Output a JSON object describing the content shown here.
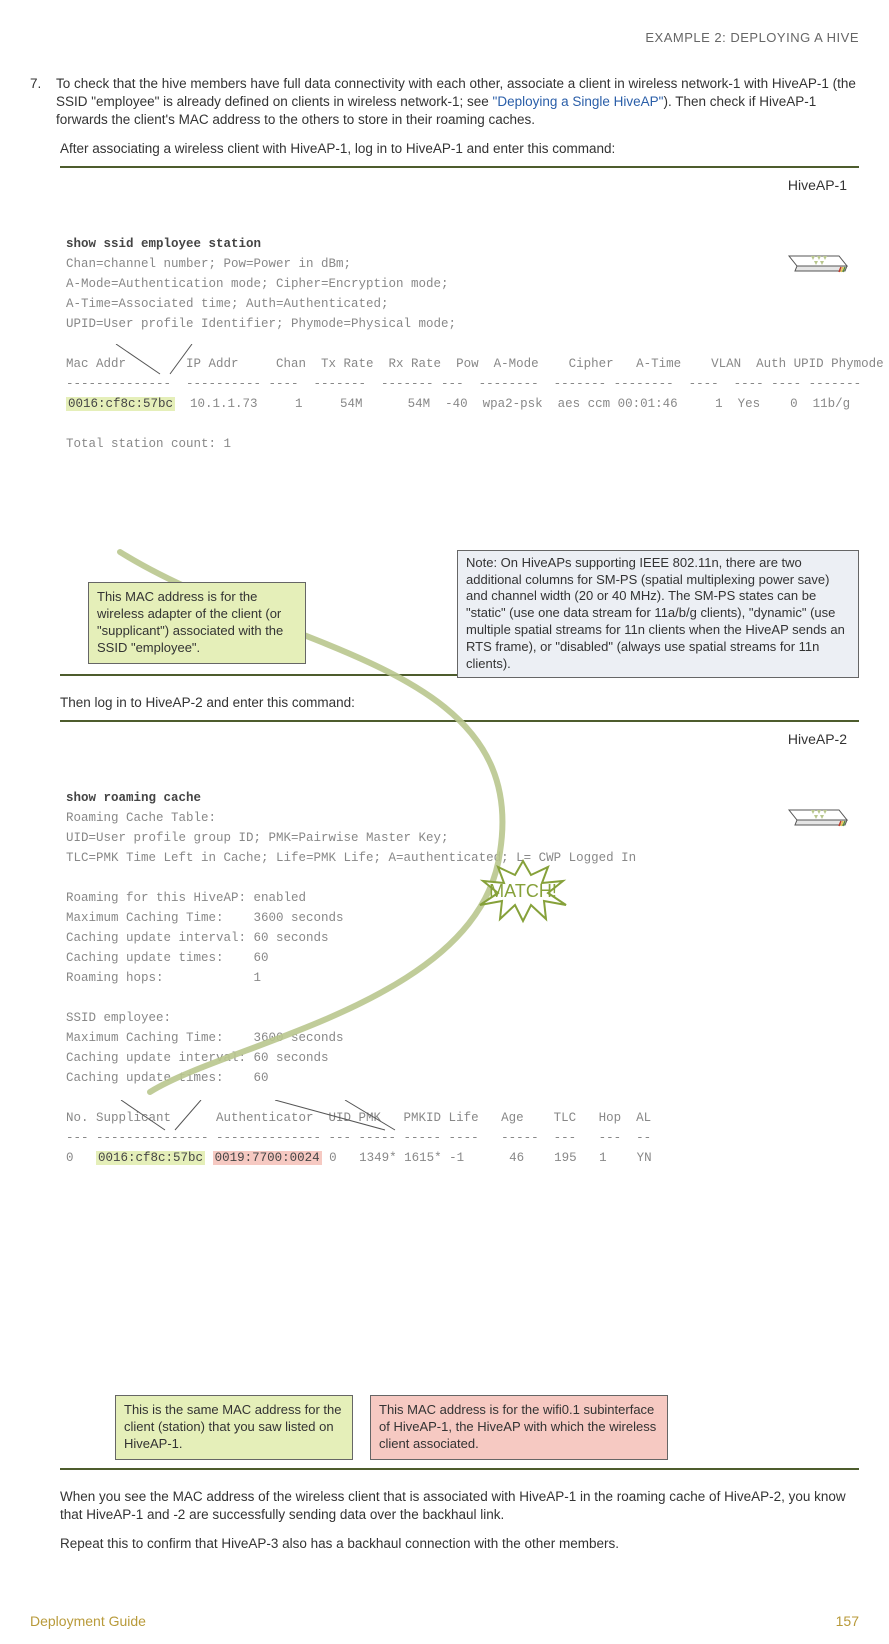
{
  "header": {
    "section": "EXAMPLE 2: DEPLOYING A HIVE"
  },
  "step": {
    "num": "7.",
    "text_before_link": "To check that the hive members have full data connectivity with each other, associate a client in wireless network-1 with HiveAP-1 (the SSID \"employee\" is already defined on clients in wireless network-1; see ",
    "link": "\"Deploying a Single HiveAP\"",
    "text_after_link": "). Then check if HiveAP-1 forwards the client's MAC address to the others to store in their roaming caches."
  },
  "intro1": "After associating a wireless client with HiveAP-1, log in to HiveAP-1 and enter this command:",
  "term1": {
    "ap_label": "HiveAP-1",
    "cmd": "show ssid employee station",
    "lines": [
      "Chan=channel number; Pow=Power in dBm;",
      "A-Mode=Authentication mode; Cipher=Encryption mode;",
      "A-Time=Associated time; Auth=Authenticated;",
      "UPID=User profile Identifier; Phymode=Physical mode;",
      "",
      "Mac Addr        IP Addr     Chan  Tx Rate  Rx Rate  Pow  A-Mode    Cipher   A-Time    VLAN  Auth UPID Phymode",
      "--------------  ---------- ----  -------  ------- ---  --------  ------- --------  ----  ---- ---- -------"
    ],
    "row_mac": "0016:cf8c:57bc",
    "row_rest": "  10.1.1.73     1     54M      54M  -40  wpa2-psk  aes ccm 00:01:46     1  Yes    0  11b/g",
    "tail": "Total station count: 1"
  },
  "callout1a": "This MAC address is for the wireless adapter of the client (or \"supplicant\") associated with the SSID \"employee\".",
  "callout1b": "Note: On HiveAPs supporting IEEE 802.11n, there are two additional columns for SM-PS (spatial multiplexing power save) and channel width (20 or 40 MHz).  The SM-PS states can be \"static\" (use one data stream for 11a/b/g clients), \"dynamic\" (use multiple spatial streams for 11n clients when the HiveAP sends an RTS frame), or \"disabled\" (always use spatial streams for 11n clients).",
  "then": "Then log in to HiveAP-2 and enter this command:",
  "term2": {
    "ap_label": "HiveAP-2",
    "cmd": "show roaming cache",
    "lines_a": [
      "Roaming Cache Table:",
      "UID=User profile group ID; PMK=Pairwise Master Key;",
      "TLC=PMK Time Left in Cache; Life=PMK Life; A=authenticated; L= CWP Logged In",
      "",
      "Roaming for this HiveAP: enabled",
      "Maximum Caching Time:    3600 seconds",
      "Caching update interval: 60 seconds",
      "Caching update times:    60",
      "Roaming hops:            1",
      "",
      "SSID employee:",
      "Maximum Caching Time:    3600 seconds",
      "Caching update interval: 60 seconds",
      "Caching update times:    60",
      "",
      "No. Supplicant      Authenticator  UID PMK   PMKID Life   Age    TLC   Hop  AL",
      "--- --------------- -------------- --- ----- ----- ----   -----  ---   ---  --"
    ],
    "row_prefix": "0   ",
    "row_supp": "0016:cf8c:57bc",
    "row_auth": "0019:7700:0024",
    "row_rest": " 0   1349* 1615* -1      46    195   1    YN"
  },
  "callout2a": "This is the same MAC address for the client (station) that you saw listed on HiveAP-1.",
  "callout2b": "This MAC address is for the wifi0.1 subinterface of HiveAP-1, the HiveAP with which the wireless client associated.",
  "match": "MATCH!",
  "conclude1": "When you see the MAC address of the wireless client that is associated with HiveAP-1 in the roaming cache of HiveAP-2, you know that HiveAP-1 and -2 are successfully sending data over the backhaul link.",
  "conclude2": "Repeat this to confirm that HiveAP-3 also has a backhaul connection with the other members.",
  "footer": {
    "left": "Deployment Guide",
    "right": "157"
  }
}
